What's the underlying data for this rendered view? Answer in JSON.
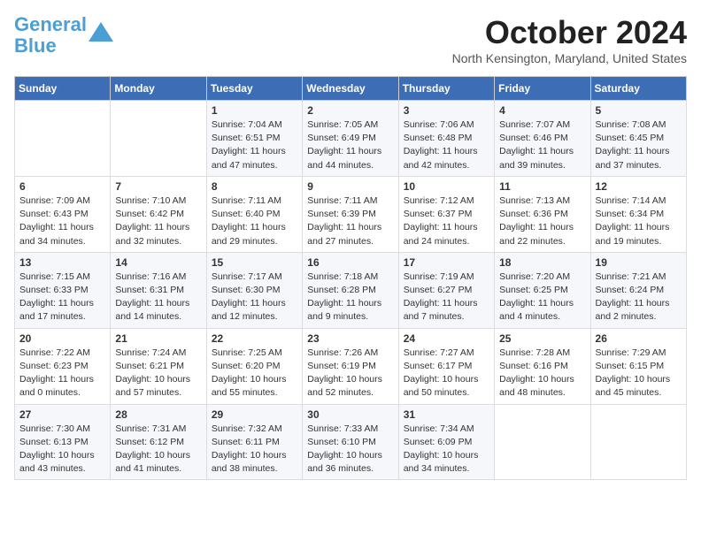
{
  "header": {
    "logo_line1": "General",
    "logo_line2": "Blue",
    "month": "October 2024",
    "location": "North Kensington, Maryland, United States"
  },
  "weekdays": [
    "Sunday",
    "Monday",
    "Tuesday",
    "Wednesday",
    "Thursday",
    "Friday",
    "Saturday"
  ],
  "weeks": [
    [
      {
        "day": "",
        "info": ""
      },
      {
        "day": "",
        "info": ""
      },
      {
        "day": "1",
        "info": "Sunrise: 7:04 AM\nSunset: 6:51 PM\nDaylight: 11 hours and 47 minutes."
      },
      {
        "day": "2",
        "info": "Sunrise: 7:05 AM\nSunset: 6:49 PM\nDaylight: 11 hours and 44 minutes."
      },
      {
        "day": "3",
        "info": "Sunrise: 7:06 AM\nSunset: 6:48 PM\nDaylight: 11 hours and 42 minutes."
      },
      {
        "day": "4",
        "info": "Sunrise: 7:07 AM\nSunset: 6:46 PM\nDaylight: 11 hours and 39 minutes."
      },
      {
        "day": "5",
        "info": "Sunrise: 7:08 AM\nSunset: 6:45 PM\nDaylight: 11 hours and 37 minutes."
      }
    ],
    [
      {
        "day": "6",
        "info": "Sunrise: 7:09 AM\nSunset: 6:43 PM\nDaylight: 11 hours and 34 minutes."
      },
      {
        "day": "7",
        "info": "Sunrise: 7:10 AM\nSunset: 6:42 PM\nDaylight: 11 hours and 32 minutes."
      },
      {
        "day": "8",
        "info": "Sunrise: 7:11 AM\nSunset: 6:40 PM\nDaylight: 11 hours and 29 minutes."
      },
      {
        "day": "9",
        "info": "Sunrise: 7:11 AM\nSunset: 6:39 PM\nDaylight: 11 hours and 27 minutes."
      },
      {
        "day": "10",
        "info": "Sunrise: 7:12 AM\nSunset: 6:37 PM\nDaylight: 11 hours and 24 minutes."
      },
      {
        "day": "11",
        "info": "Sunrise: 7:13 AM\nSunset: 6:36 PM\nDaylight: 11 hours and 22 minutes."
      },
      {
        "day": "12",
        "info": "Sunrise: 7:14 AM\nSunset: 6:34 PM\nDaylight: 11 hours and 19 minutes."
      }
    ],
    [
      {
        "day": "13",
        "info": "Sunrise: 7:15 AM\nSunset: 6:33 PM\nDaylight: 11 hours and 17 minutes."
      },
      {
        "day": "14",
        "info": "Sunrise: 7:16 AM\nSunset: 6:31 PM\nDaylight: 11 hours and 14 minutes."
      },
      {
        "day": "15",
        "info": "Sunrise: 7:17 AM\nSunset: 6:30 PM\nDaylight: 11 hours and 12 minutes."
      },
      {
        "day": "16",
        "info": "Sunrise: 7:18 AM\nSunset: 6:28 PM\nDaylight: 11 hours and 9 minutes."
      },
      {
        "day": "17",
        "info": "Sunrise: 7:19 AM\nSunset: 6:27 PM\nDaylight: 11 hours and 7 minutes."
      },
      {
        "day": "18",
        "info": "Sunrise: 7:20 AM\nSunset: 6:25 PM\nDaylight: 11 hours and 4 minutes."
      },
      {
        "day": "19",
        "info": "Sunrise: 7:21 AM\nSunset: 6:24 PM\nDaylight: 11 hours and 2 minutes."
      }
    ],
    [
      {
        "day": "20",
        "info": "Sunrise: 7:22 AM\nSunset: 6:23 PM\nDaylight: 11 hours and 0 minutes."
      },
      {
        "day": "21",
        "info": "Sunrise: 7:24 AM\nSunset: 6:21 PM\nDaylight: 10 hours and 57 minutes."
      },
      {
        "day": "22",
        "info": "Sunrise: 7:25 AM\nSunset: 6:20 PM\nDaylight: 10 hours and 55 minutes."
      },
      {
        "day": "23",
        "info": "Sunrise: 7:26 AM\nSunset: 6:19 PM\nDaylight: 10 hours and 52 minutes."
      },
      {
        "day": "24",
        "info": "Sunrise: 7:27 AM\nSunset: 6:17 PM\nDaylight: 10 hours and 50 minutes."
      },
      {
        "day": "25",
        "info": "Sunrise: 7:28 AM\nSunset: 6:16 PM\nDaylight: 10 hours and 48 minutes."
      },
      {
        "day": "26",
        "info": "Sunrise: 7:29 AM\nSunset: 6:15 PM\nDaylight: 10 hours and 45 minutes."
      }
    ],
    [
      {
        "day": "27",
        "info": "Sunrise: 7:30 AM\nSunset: 6:13 PM\nDaylight: 10 hours and 43 minutes."
      },
      {
        "day": "28",
        "info": "Sunrise: 7:31 AM\nSunset: 6:12 PM\nDaylight: 10 hours and 41 minutes."
      },
      {
        "day": "29",
        "info": "Sunrise: 7:32 AM\nSunset: 6:11 PM\nDaylight: 10 hours and 38 minutes."
      },
      {
        "day": "30",
        "info": "Sunrise: 7:33 AM\nSunset: 6:10 PM\nDaylight: 10 hours and 36 minutes."
      },
      {
        "day": "31",
        "info": "Sunrise: 7:34 AM\nSunset: 6:09 PM\nDaylight: 10 hours and 34 minutes."
      },
      {
        "day": "",
        "info": ""
      },
      {
        "day": "",
        "info": ""
      }
    ]
  ]
}
